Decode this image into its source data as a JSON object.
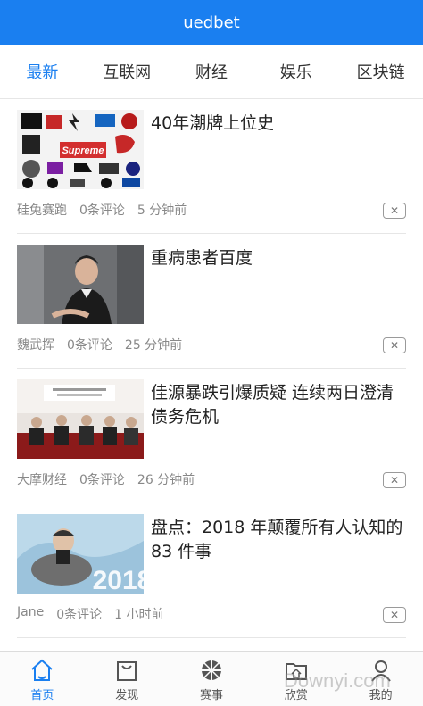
{
  "header": {
    "title": "uedbet"
  },
  "tabs": [
    {
      "label": "最新",
      "active": true
    },
    {
      "label": "互联网"
    },
    {
      "label": "财经"
    },
    {
      "label": "娱乐"
    },
    {
      "label": "区块链"
    }
  ],
  "articles": [
    {
      "title": "40年潮牌上位史",
      "source": "硅兔赛跑",
      "comments": "0条评论",
      "time": "5 分钟前"
    },
    {
      "title": "重病患者百度",
      "source": "魏武挥",
      "comments": "0条评论",
      "time": "25 分钟前"
    },
    {
      "title": "佳源暴跌引爆质疑 连续两日澄清债务危机",
      "source": "大摩财经",
      "comments": "0条评论",
      "time": "26 分钟前"
    },
    {
      "title": "盘点：2018 年颠覆所有人认知的 83 件事",
      "source": "Jane",
      "comments": "0条评论",
      "time": "1 小时前",
      "image_text": "2018"
    }
  ],
  "close_symbol": "✕",
  "thumbnail_text": {
    "supreme": "Supreme"
  },
  "bottom_nav": [
    {
      "label": "首页",
      "icon": "home-icon",
      "active": true
    },
    {
      "label": "发现",
      "icon": "bag-icon"
    },
    {
      "label": "赛事",
      "icon": "ball-icon"
    },
    {
      "label": "欣赏",
      "icon": "folder-home-icon"
    },
    {
      "label": "我的",
      "icon": "user-icon"
    }
  ],
  "watermark": "Downyi.com",
  "colors": {
    "accent": "#1a7ff0"
  }
}
